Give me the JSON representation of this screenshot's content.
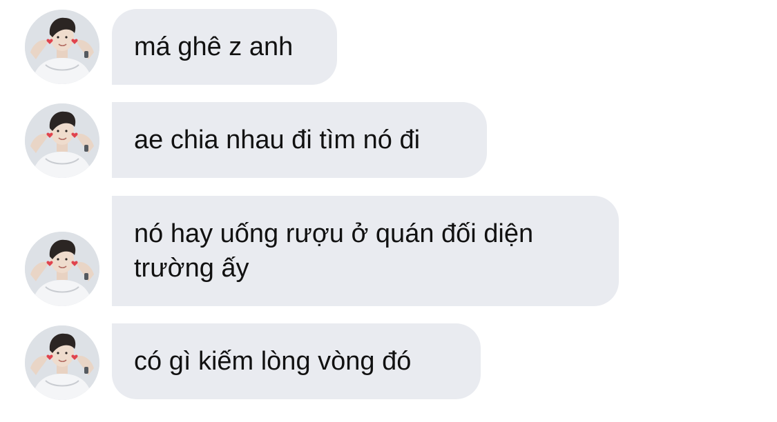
{
  "conversation": {
    "messages": [
      {
        "text": "má ghê z anh"
      },
      {
        "text": "ae chia nhau đi tìm nó đi"
      },
      {
        "text": "nó hay uống rượu ở quán đối diện\ntrường ấy"
      },
      {
        "text": "có gì kiếm lòng vòng đó"
      }
    ]
  },
  "colors": {
    "bubble_background": "#e9ebf0",
    "text": "#111111",
    "page_background": "#ffffff"
  },
  "icons": {
    "avatar": "avatar-photo-icon"
  }
}
